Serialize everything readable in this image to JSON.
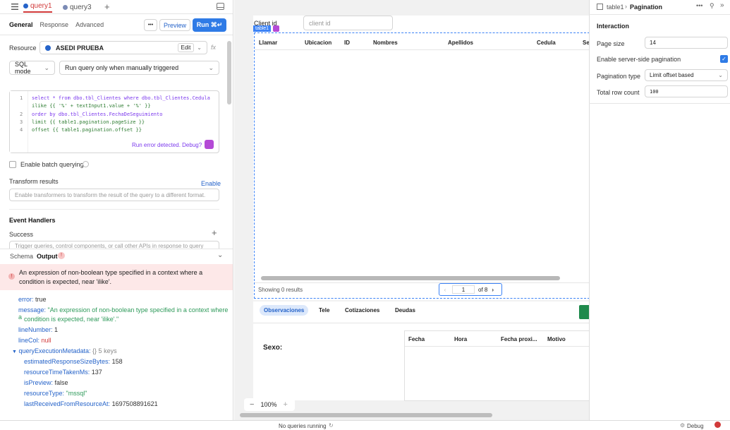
{
  "query_tabs": [
    {
      "label": "query1",
      "active": true
    },
    {
      "label": "query3",
      "active": false
    }
  ],
  "subtabs": [
    "General",
    "Response",
    "Advanced"
  ],
  "toolbar": {
    "more_label": "•••",
    "preview_label": "Preview",
    "run_label": "Run ⌘↵"
  },
  "resource": {
    "label": "Resource",
    "value": "ASEDI PRUEBA",
    "edit_label": "Edit",
    "fx_label": "fx"
  },
  "mode": {
    "value": "SQL mode",
    "trigger": "Run query only when manually triggered"
  },
  "code": {
    "lines": [
      "1",
      "",
      "2",
      "3",
      "4"
    ],
    "l1": "select * from dbo.tbl_Clientes where dbo.tbl_Clientes.Cedula",
    "l1b": "ilike {{ '%' + textInput1.value + '%' }}",
    "l2": "order by dbo.tbl_Clientes.FechaDeSeguimiento",
    "l3": "limit {{ table1.pagination.pageSize }}",
    "l4": "offset {{ table1.pagination.offset }}",
    "error_hint": "Run error detected. Debug?"
  },
  "batch": {
    "label": "Enable batch querying"
  },
  "transform": {
    "label": "Transform results",
    "enable_label": "Enable",
    "placeholder": "Enable transformers to transform the result of the query to a different format."
  },
  "events": {
    "title": "Event Handlers",
    "success_label": "Success",
    "success_placeholder": "Trigger queries, control components, or call other APIs in response to query"
  },
  "output_tabs": {
    "schema": "Schema",
    "output": "Output"
  },
  "error_banner": "An expression of non-boolean type specified in a context where a condition is expected, near 'ilike'.",
  "output": {
    "error_key": "error:",
    "error_val": "true",
    "message_key": "message:",
    "message_val": "\"An expression of non-boolean type specified in a context where a",
    "message_val2": "condition is expected, near 'ilike'.\"",
    "lineNumber_key": "lineNumber:",
    "lineNumber_val": "1",
    "lineCol_key": "lineCol:",
    "lineCol_val": "null",
    "meta_key": "queryExecutionMetadata:",
    "meta_val": "{} 5 keys",
    "estimated_key": "estimatedResponseSizeBytes:",
    "estimated_val": "158",
    "time_key": "resourceTimeTakenMs:",
    "time_val": "137",
    "preview_key": "isPreview:",
    "preview_val": "false",
    "type_key": "resourceType:",
    "type_val": "\"mssql\"",
    "received_key": "lastReceivedFromResourceAt:",
    "received_val": "1697508891621"
  },
  "canvas": {
    "client_label": "Client id",
    "client_placeholder": "client id",
    "table_tag": "table1",
    "columns": [
      "Llamar",
      "Ubicacion",
      "ID",
      "Nombres",
      "Apellidos",
      "Cedula",
      "Se"
    ],
    "showing": "Showing 0 results",
    "page_current": "1",
    "page_of": "of 8",
    "tabs": [
      "Observaciones",
      "Tele",
      "Cotizaciones",
      "Deudas"
    ],
    "sexo_label": "Sexo:",
    "sub_columns": [
      "Fecha",
      "Hora",
      "Fecha proxi...",
      "Motivo"
    ],
    "zoom": "100%"
  },
  "inspector": {
    "breadcrumb_parent": "table1",
    "breadcrumb_current": "Pagination",
    "section": "Interaction",
    "page_size_label": "Page size",
    "page_size_value": "14",
    "server_side_label": "Enable server-side pagination",
    "pagination_type_label": "Pagination type",
    "pagination_type_value": "Limit offset based",
    "total_row_label": "Total row count",
    "total_row_value": "100"
  },
  "status": {
    "queries": "No queries running",
    "debug": "Debug"
  },
  "colors": {
    "accent": "#3b82f6",
    "error_bg": "#fde8e8",
    "key_blue": "#2563c9",
    "string_green": "#2e9a5a"
  }
}
